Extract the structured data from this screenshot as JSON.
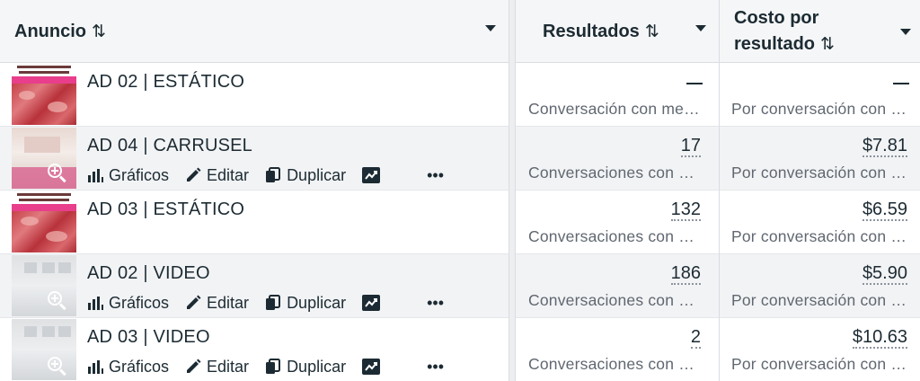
{
  "header": {
    "col_name": "Anuncio",
    "col_results": "Resultados",
    "col_cost_line1": "Costo por",
    "col_cost_line2": "resultado",
    "sort_glyph": "⇅"
  },
  "actions": {
    "charts": "Gráficos",
    "edit": "Editar",
    "duplicate": "Duplicar",
    "more": "•••"
  },
  "rows": [
    {
      "name": "AD 02 | ESTÁTICO",
      "results": "—",
      "results_sub": "Conversación con mensajes iniciada",
      "cost": "—",
      "cost_sub": "Por conversación con mensajes iniciada",
      "thumbnail": "meat-promo-image"
    },
    {
      "name": "AD 04 | CARRUSEL",
      "results": "17",
      "results_sub": "Conversaciones con mensajes iniciadas",
      "cost": "$7.81",
      "cost_sub": "Por conversación con mensajes iniciada",
      "thumbnail": "storefront-image"
    },
    {
      "name": "AD 03 | ESTÁTICO",
      "results": "132",
      "results_sub": "Conversaciones con mensajes iniciadas",
      "cost": "$6.59",
      "cost_sub": "Por conversación con mensajes iniciada",
      "thumbnail": "meat-promo-image"
    },
    {
      "name": "AD 02 | VIDEO",
      "results": "186",
      "results_sub": "Conversaciones con mensajes iniciadas",
      "cost": "$5.90",
      "cost_sub": "Por conversación con mensajes iniciada",
      "thumbnail": "video-frame-image"
    },
    {
      "name": "AD 03 | VIDEO",
      "results": "2",
      "results_sub": "Conversaciones con mensajes iniciadas",
      "cost": "$10.63",
      "cost_sub": "Por conversación con mensajes iniciada",
      "thumbnail": "video-frame-image"
    }
  ],
  "colors": {
    "text": "#1c2b33",
    "subtext": "#606770",
    "header_bg": "#f5f6f7",
    "alt_row_bg": "#f2f3f5",
    "border": "#dadde1"
  },
  "icons": [
    "sort-icon",
    "dropdown-caret-icon",
    "bar-chart-icon",
    "pencil-icon",
    "duplicate-icon",
    "trend-chart-icon",
    "more-dots-icon",
    "zoom-in-icon"
  ]
}
